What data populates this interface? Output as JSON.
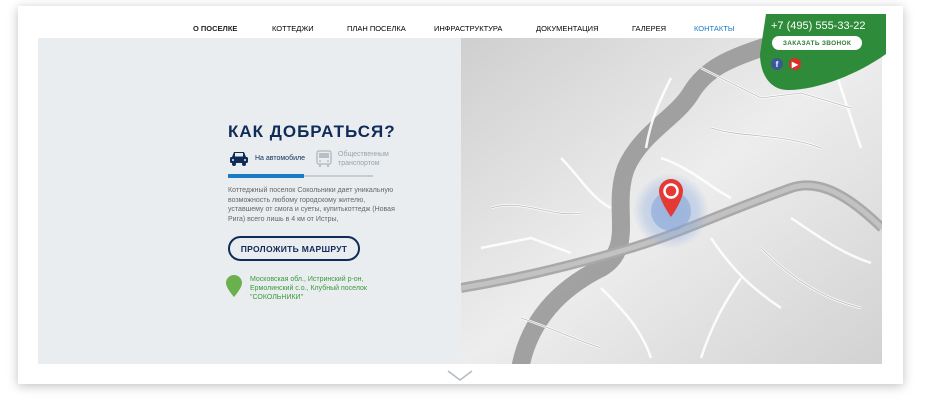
{
  "nav": {
    "items": [
      {
        "label": "О ПОСЕЛКЕ"
      },
      {
        "label": "КОТТЕДЖИ"
      },
      {
        "label": "ПЛАН ПОСЕЛКА"
      },
      {
        "label": "ИНФРАСТРУКТУРА"
      },
      {
        "label": "ДОКУМЕНТАЦИЯ"
      },
      {
        "label": "ГАЛЕРЕЯ"
      },
      {
        "label": "КОНТАКТЫ"
      }
    ],
    "active": "КОНТАКТЫ"
  },
  "contact": {
    "phone": "+7 (495) 555-33-22",
    "callback_label": "ЗАКАЗАТЬ ЗВОНОК",
    "social": [
      "facebook-icon",
      "youtube-icon"
    ]
  },
  "directions": {
    "title": "КАК ДОБРАТЬСЯ?",
    "tabs": [
      {
        "label": "На автомобиле",
        "icon": "car-icon",
        "active": true
      },
      {
        "label": "Общественным транспортом",
        "icon": "bus-icon",
        "active": false
      }
    ],
    "description": "Коттеджный поселок Сокольники дает уникальную возможность любому городскому жителю, уставшему от смога и суеты, купитькоттедж (Новая Рига) всего лишь в 4 км от Истры,",
    "route_button": "ПРОЛОЖИТЬ МАРШРУТ",
    "address": "Московская обл., Истринский р-он, Ермолинский с.о., Клубный поселок \"СОКОЛЬНИКИ\""
  },
  "map": {
    "marker_icon": "map-marker-icon",
    "colors": {
      "marker": "#e53935",
      "halo": "#7f9fd6",
      "river": "#8e8e8e",
      "road": "#a8a8a8"
    }
  },
  "colors": {
    "brand_navy": "#0f2b57",
    "accent_blue": "#1a7bc4",
    "green": "#3b9a3b",
    "panel_bg": "#eaedf0"
  }
}
